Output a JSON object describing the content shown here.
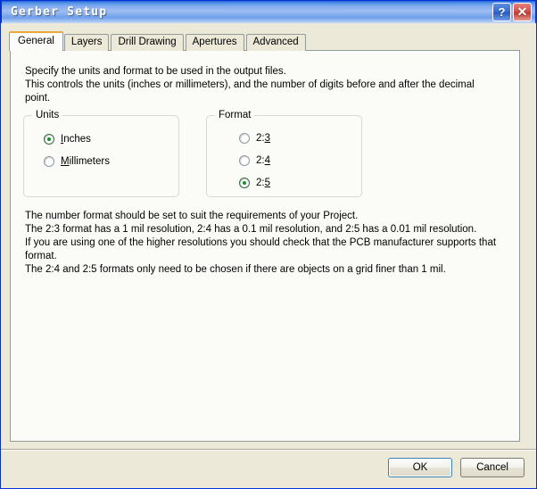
{
  "window": {
    "title": "Gerber Setup",
    "help_button": "?",
    "close_button": "✕",
    "help_icon_name": "help-icon",
    "close_icon_name": "close-icon",
    "border_color": "#0831d9",
    "titlebar_gradient_start": "#1c62d1",
    "dialog_background": "#ece9d8"
  },
  "tabs": [
    {
      "label": "General",
      "active": true
    },
    {
      "label": "Layers",
      "active": false
    },
    {
      "label": "Drill Drawing",
      "active": false
    },
    {
      "label": "Apertures",
      "active": false
    },
    {
      "label": "Advanced",
      "active": false
    }
  ],
  "content": {
    "intro_text": "Specify the units and format to be used in the output files.\nThis controls the units (inches or millimeters), and the number of digits before and after the decimal point.",
    "detail_text": "The number format should be set to suit the requirements of your Project.\nThe 2:3 format has a 1 mil resolution, 2:4 has a 0.1 mil resolution, and 2:5 has a 0.01 mil resolution.\nIf you are using one of the higher resolutions you should check that the PCB manufacturer supports that format.\nThe 2:4 and 2:5 formats only need to be chosen if there are objects on a grid finer than 1 mil.",
    "units_group": {
      "label": "Units",
      "options": [
        {
          "label_pre": "",
          "mnemonic": "I",
          "label_post": "nches",
          "checked": true
        },
        {
          "label_pre": "",
          "mnemonic": "M",
          "label_post": "illimeters",
          "checked": false
        }
      ]
    },
    "format_group": {
      "label": "Format",
      "options": [
        {
          "label_pre": "2:",
          "mnemonic": "3",
          "label_post": "",
          "checked": false
        },
        {
          "label_pre": "2:",
          "mnemonic": "4",
          "label_post": "",
          "checked": false
        },
        {
          "label_pre": "2:",
          "mnemonic": "5",
          "label_post": "",
          "checked": true
        }
      ]
    },
    "selected_units": "Inches",
    "selected_format": "2:5"
  },
  "footer": {
    "ok_label": "OK",
    "cancel_label": "Cancel"
  }
}
